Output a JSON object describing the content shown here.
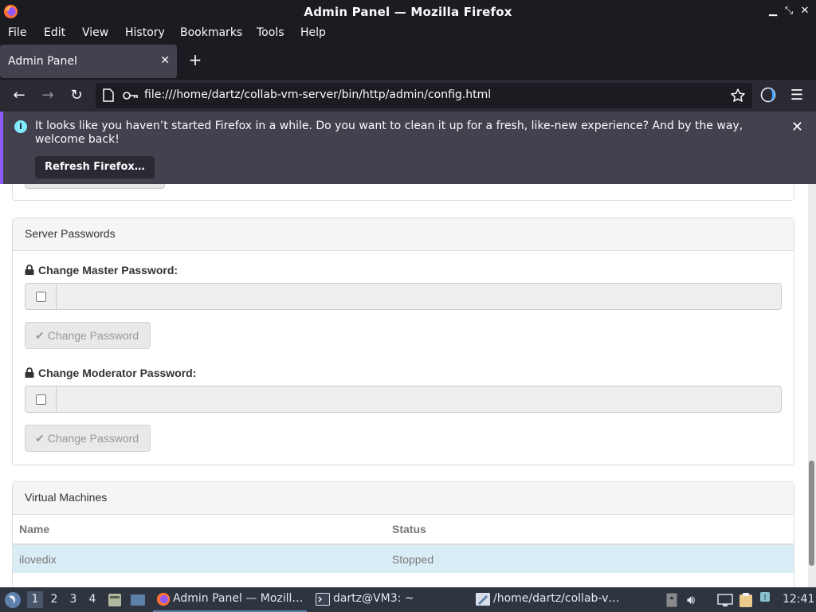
{
  "window": {
    "title": "Admin Panel — Mozilla Firefox"
  },
  "menu": {
    "file": "File",
    "edit": "Edit",
    "view": "View",
    "history": "History",
    "bookmarks": "Bookmarks",
    "tools": "Tools",
    "help": "Help"
  },
  "tabs": [
    {
      "label": "Admin Panel"
    }
  ],
  "address": {
    "url": "file:///home/dartz/collab-vm-server/bin/http/admin/config.html"
  },
  "notification": {
    "message": "It looks like you haven’t started Firefox in a while. Do you want to clean it up for a fresh, like-new experience? And by the way, welcome back!",
    "button": "Refresh Firefox…"
  },
  "server_passwords": {
    "title": "Server Passwords",
    "master_label": "Change Master Password:",
    "moderator_label": "Change Moderator Password:",
    "button_label": "Change Password"
  },
  "virtual_machines": {
    "title": "Virtual Machines",
    "columns": [
      "Name",
      "Status"
    ],
    "rows": [
      {
        "name": "ilovedix",
        "status": "Stopped"
      }
    ]
  },
  "taskbar": {
    "workspaces": [
      "1",
      "2",
      "3",
      "4"
    ],
    "tasks": [
      "Admin Panel — Mozill…",
      "dartz@VM3: ~",
      "/home/dartz/collab-v…"
    ],
    "clock": "12:41"
  },
  "colors": {
    "titlebar": "#1c1b22",
    "navbar": "#2b2a33",
    "notification": "#42414d",
    "notification_accent": "#9059ff",
    "table_row_highlight": "#d9edf7",
    "taskbar": "#2e3440"
  }
}
